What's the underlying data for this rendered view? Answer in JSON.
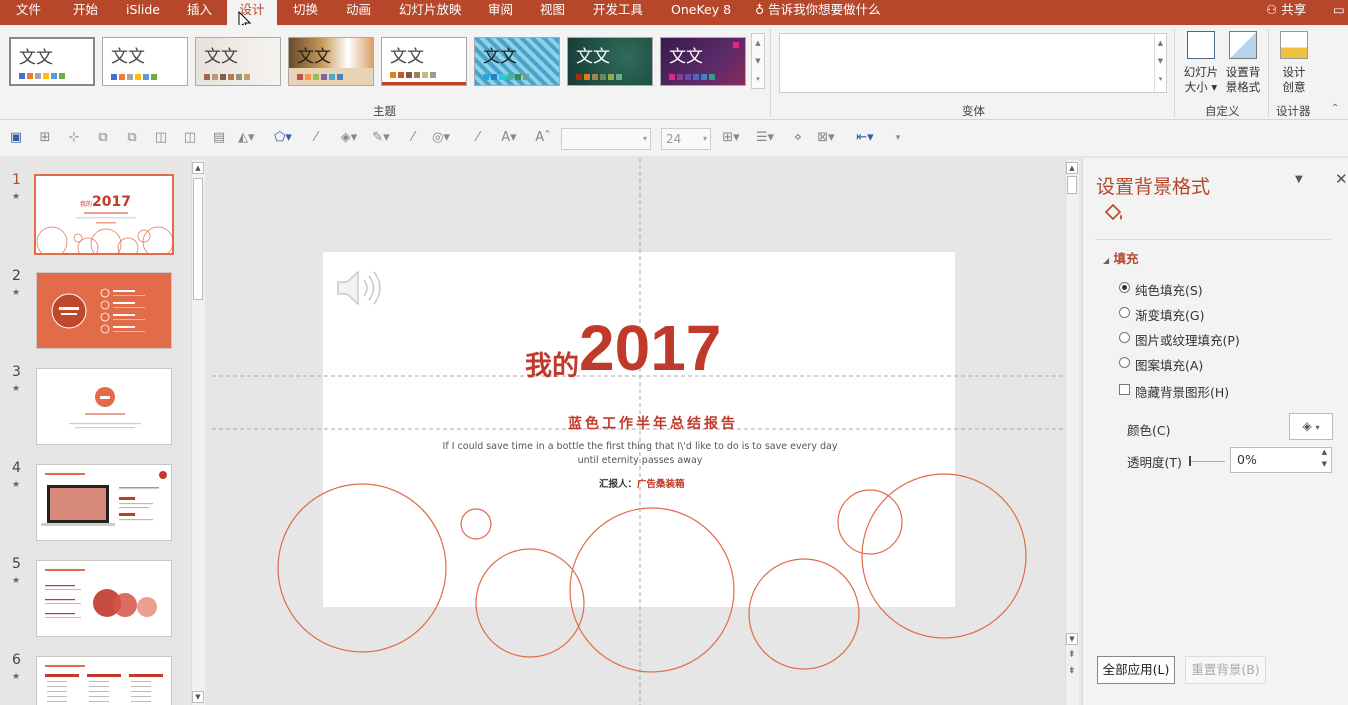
{
  "menu": {
    "tabs": [
      "文件",
      "开始",
      "iSlide",
      "插入",
      "设计",
      "切换",
      "动画",
      "幻灯片放映",
      "审阅",
      "视图",
      "开发工具",
      "OneKey 8"
    ],
    "active_tab": "设计",
    "tell_me": "告诉我你想要做什么",
    "share": "共享"
  },
  "ribbon": {
    "theme_sample_text": "文文",
    "themes_group_label": "主题",
    "variants_group_label": "变体",
    "customize_group_label": "自定义",
    "designer_group_label": "设计器",
    "slide_size_line1": "幻灯片",
    "slide_size_line2": "大小",
    "format_bg_line1": "设置背",
    "format_bg_line2": "景格式",
    "design_ideas_line1": "设计",
    "design_ideas_line2": "创意"
  },
  "quick_access": {
    "font_size": "24"
  },
  "thumbnails": [
    {
      "num": "1",
      "star": "★"
    },
    {
      "num": "2",
      "star": "★"
    },
    {
      "num": "3",
      "star": "★"
    },
    {
      "num": "4",
      "star": "★"
    },
    {
      "num": "5",
      "star": "★"
    },
    {
      "num": "6",
      "star": "★"
    }
  ],
  "slide": {
    "title_prefix": "我的",
    "title_year": "2017",
    "subtitle": "蓝色工作半年总结报告",
    "quote_line1": "If I could save time in a bottle the first thing that I\\'d like to do is to save every day",
    "quote_line2": "until eternity passes away",
    "reporter_label": "汇报人：",
    "reporter_name": "广告桑装箱"
  },
  "panel": {
    "title": "设置背景格式",
    "section_fill": "填充",
    "options": [
      "纯色填充(S)",
      "渐变填充(G)",
      "图片或纹理填充(P)",
      "图案填充(A)"
    ],
    "selected_option": "纯色填充(S)",
    "hide_bg_graphics": "隐藏背景图形(H)",
    "color_label": "颜色(C)",
    "transparency_label": "透明度(T)",
    "transparency_value": "0%",
    "apply_all": "全部应用(L)",
    "reset_bg": "重置背景(B)"
  },
  "colors": {
    "brand": "#b7472a",
    "accent": "#e26b4a",
    "slide_red": "#c0392b"
  }
}
